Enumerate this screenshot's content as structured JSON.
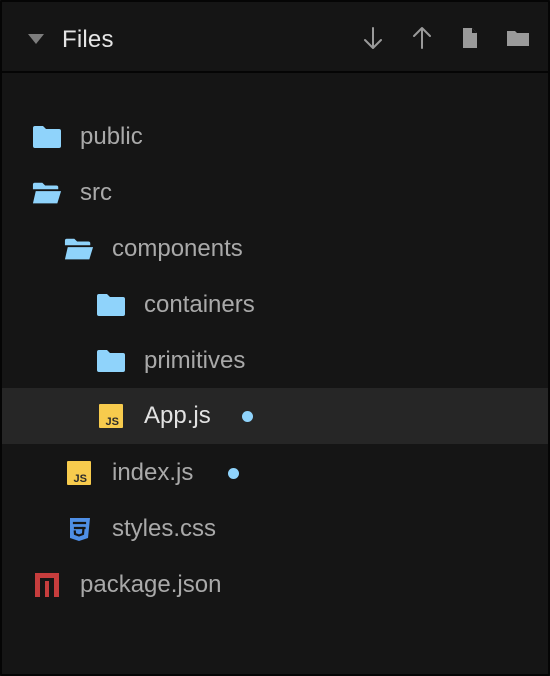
{
  "header": {
    "title": "Files",
    "actions": [
      {
        "name": "download-icon"
      },
      {
        "name": "upload-icon"
      },
      {
        "name": "new-file-icon"
      },
      {
        "name": "new-folder-icon"
      }
    ]
  },
  "tree": {
    "items": [
      {
        "label": "public",
        "type": "folder",
        "open": false,
        "depth": 0
      },
      {
        "label": "src",
        "type": "folder",
        "open": true,
        "depth": 0
      },
      {
        "label": "components",
        "type": "folder",
        "open": true,
        "depth": 1
      },
      {
        "label": "containers",
        "type": "folder",
        "open": false,
        "depth": 2
      },
      {
        "label": "primitives",
        "type": "folder",
        "open": false,
        "depth": 2
      },
      {
        "label": "App.js",
        "type": "js",
        "depth": 2,
        "selected": true,
        "modified": true
      },
      {
        "label": "index.js",
        "type": "js",
        "depth": 1,
        "modified": true
      },
      {
        "label": "styles.css",
        "type": "css",
        "depth": 1
      },
      {
        "label": "package.json",
        "type": "npm",
        "depth": 0
      }
    ]
  },
  "colors": {
    "folder": "#8fd3fb",
    "js_badge": "#f7cb4d",
    "css": "#4f8fe6",
    "npm": "#c63d3d",
    "modified_dot": "#8fd3fb",
    "selected_row": "#262626"
  }
}
